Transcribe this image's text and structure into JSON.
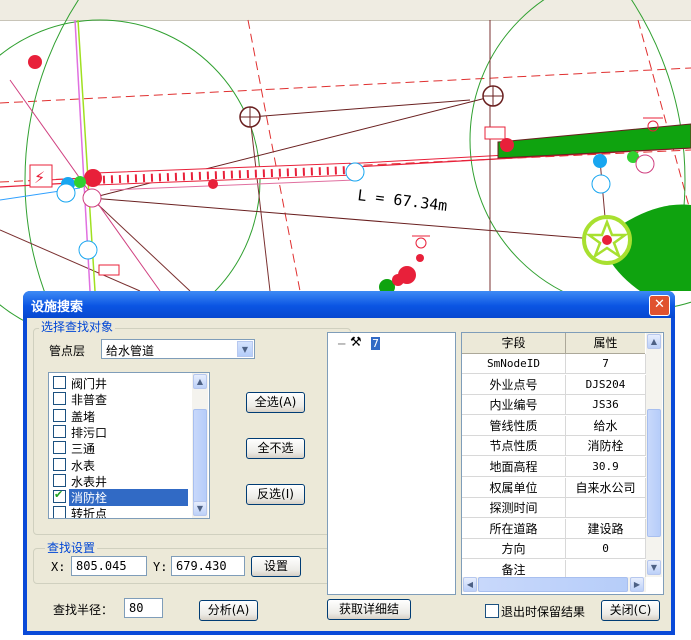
{
  "map": {
    "measure_label": "L = 67.34m"
  },
  "dialog": {
    "title": "设施搜索",
    "close_symbol": "✕",
    "select_group": {
      "label": "选择查找对象",
      "layer_label": "管点层",
      "layer_value": "给水管道",
      "items": [
        {
          "label": "阀门井",
          "checked": false,
          "selected": false
        },
        {
          "label": "非普查",
          "checked": false,
          "selected": false
        },
        {
          "label": "盖堵",
          "checked": false,
          "selected": false
        },
        {
          "label": "排污口",
          "checked": false,
          "selected": false
        },
        {
          "label": "三通",
          "checked": false,
          "selected": false
        },
        {
          "label": "水表",
          "checked": false,
          "selected": false
        },
        {
          "label": "水表井",
          "checked": false,
          "selected": false
        },
        {
          "label": "消防栓",
          "checked": true,
          "selected": true
        },
        {
          "label": "转折点",
          "checked": false,
          "selected": false
        }
      ],
      "select_all": "全选(A)",
      "select_none": "全不选",
      "invert": "反选(I)"
    },
    "search_settings": {
      "label": "查找设置",
      "x_label": "X:",
      "x_value": "805.045",
      "y_label": "Y:",
      "y_value": "679.430",
      "set_button": "设置"
    },
    "radius_label": "查找半径：",
    "radius_value": "80",
    "analyze_button": "分析(A)",
    "tree": {
      "node_label": "7"
    },
    "grid": {
      "headers": [
        "字段",
        "属性"
      ],
      "rows": [
        [
          "SmNodeID",
          "7"
        ],
        [
          "外业点号",
          "DJS204"
        ],
        [
          "内业编号",
          "JS36"
        ],
        [
          "管线性质",
          "给水"
        ],
        [
          "节点性质",
          "消防栓"
        ],
        [
          "地面高程",
          "30.9"
        ],
        [
          "权属单位",
          "自来水公司"
        ],
        [
          "探测时间",
          ""
        ],
        [
          "所在道路",
          "建设路"
        ],
        [
          "方向",
          "0"
        ],
        [
          "备注",
          ""
        ]
      ]
    },
    "details_button": "获取详细结",
    "keep_results_label": "退出时保留结果",
    "keep_results_checked": false,
    "close_button": "关闭(C)"
  },
  "colors": {
    "title_bar": "#0b55e3",
    "dialog_bg": "#ece9d8",
    "selection": "#316ac5",
    "pipe_red": "#e8203a",
    "green_fill": "#0fa30f"
  }
}
